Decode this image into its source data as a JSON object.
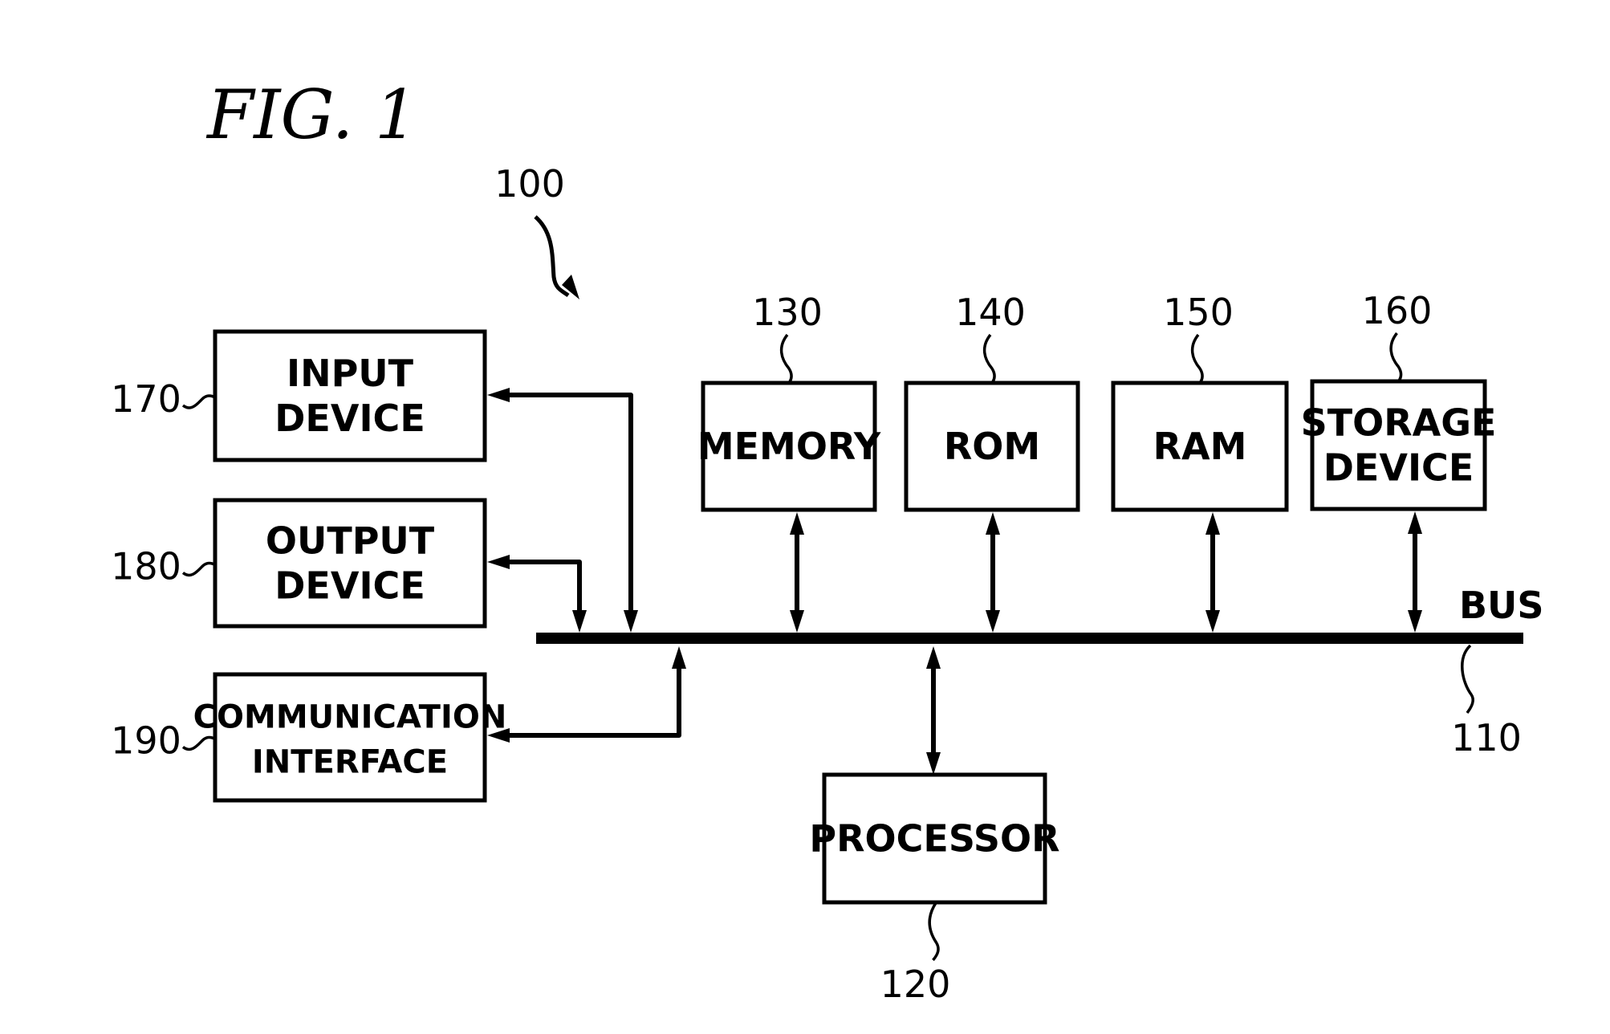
{
  "figure": {
    "title": "FIG. 1",
    "system_ref": "100"
  },
  "bus": {
    "label": "BUS",
    "ref": "110"
  },
  "components": [
    {
      "id": "processor",
      "ref": "120",
      "lines": [
        "PROCESSOR"
      ]
    },
    {
      "id": "memory",
      "ref": "130",
      "lines": [
        "MEMORY"
      ]
    },
    {
      "id": "rom",
      "ref": "140",
      "lines": [
        "ROM"
      ]
    },
    {
      "id": "ram",
      "ref": "150",
      "lines": [
        "RAM"
      ]
    },
    {
      "id": "storage-device",
      "ref": "160",
      "lines": [
        "STORAGE",
        "DEVICE"
      ]
    },
    {
      "id": "input-device",
      "ref": "170",
      "lines": [
        "INPUT",
        "DEVICE"
      ]
    },
    {
      "id": "output-device",
      "ref": "180",
      "lines": [
        "OUTPUT",
        "DEVICE"
      ]
    },
    {
      "id": "communication-interface",
      "ref": "190",
      "lines": [
        "COMMUNICATION",
        "INTERFACE"
      ]
    }
  ],
  "connections": [
    {
      "from": "memory",
      "to": "bus",
      "direction": "bidirectional"
    },
    {
      "from": "rom",
      "to": "bus",
      "direction": "bidirectional"
    },
    {
      "from": "ram",
      "to": "bus",
      "direction": "bidirectional"
    },
    {
      "from": "storage-device",
      "to": "bus",
      "direction": "bidirectional"
    },
    {
      "from": "processor",
      "to": "bus",
      "direction": "bidirectional"
    },
    {
      "from": "input-device",
      "to": "bus",
      "direction": "bidirectional"
    },
    {
      "from": "output-device",
      "to": "bus",
      "direction": "bidirectional"
    },
    {
      "from": "communication-interface",
      "to": "bus",
      "direction": "bidirectional"
    }
  ]
}
